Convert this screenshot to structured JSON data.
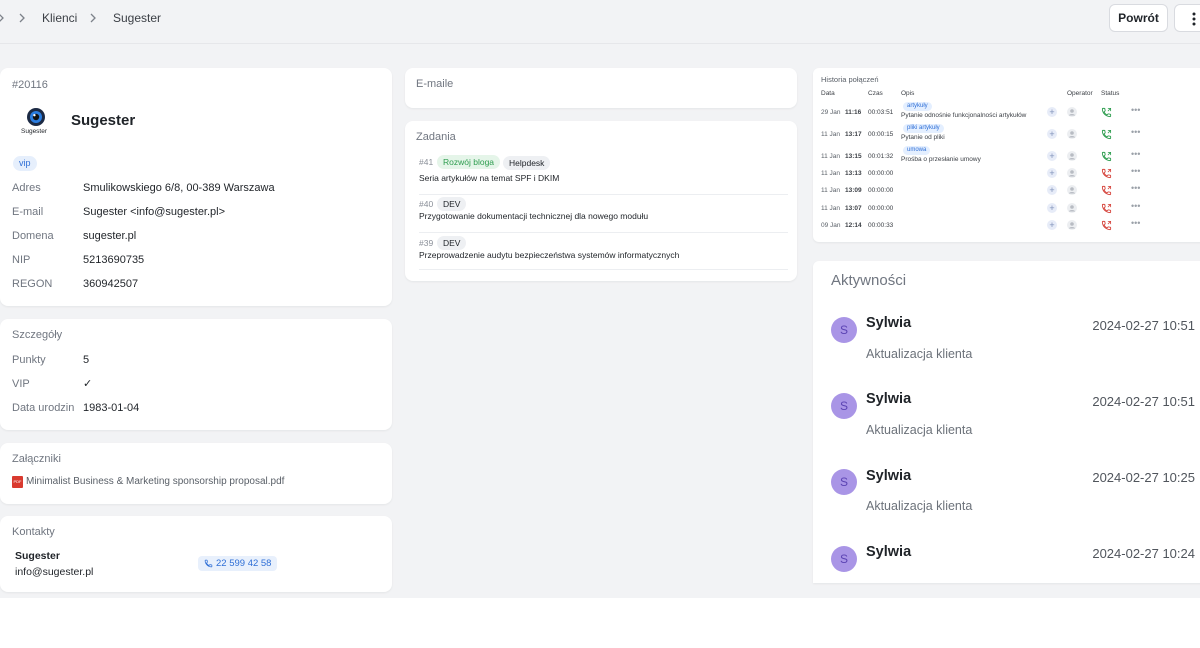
{
  "breadcrumb": {
    "items": [
      "Klienci",
      "Sugester"
    ]
  },
  "header": {
    "back_label": "Powrót"
  },
  "client": {
    "id": "#20116",
    "logo_text": "Sugester",
    "name": "Sugester",
    "tag": "vip",
    "fields": [
      {
        "label": "Adres",
        "value": "Smulikowskiego 6/8, 00-389 Warszawa"
      },
      {
        "label": "E-mail",
        "value": "Sugester <info@sugester.pl>"
      },
      {
        "label": "Domena",
        "value": "sugester.pl"
      },
      {
        "label": "NIP",
        "value": "5213690735"
      },
      {
        "label": "REGON",
        "value": "360942507"
      }
    ]
  },
  "details": {
    "title": "Szczegóły",
    "fields": [
      {
        "label": "Punkty",
        "value": "5"
      },
      {
        "label": "VIP",
        "value": "✓"
      },
      {
        "label": "Data urodzin",
        "value": "1983-01-04"
      }
    ]
  },
  "attachments": {
    "title": "Załączniki",
    "file_icon": "PDF",
    "files": [
      "Minimalist Business & Marketing sponsorship proposal.pdf"
    ]
  },
  "contacts": {
    "title": "Kontakty",
    "items": [
      {
        "name": "Sugester",
        "email": "info@sugester.pl",
        "phone": "22 599 42 58"
      }
    ]
  },
  "emails": {
    "title": "E-maile"
  },
  "tasks": {
    "title": "Zadania",
    "items": [
      {
        "number": "#41",
        "tags": [
          "Rozwój bloga",
          "Helpdesk"
        ],
        "title": "Seria artykułów na temat SPF i DKIM"
      },
      {
        "number": "#40",
        "tags": [
          "DEV"
        ],
        "title": "Przygotowanie dokumentacji technicznej dla nowego modułu"
      },
      {
        "number": "#39",
        "tags": [
          "DEV"
        ],
        "title": "Przeprowadzenie audytu bezpieczeństwa systemów informatycznych"
      }
    ]
  },
  "call_history": {
    "title": "Historia połączeń",
    "columns": [
      "Data",
      "Czas",
      "Opis",
      "Operator",
      "Status"
    ],
    "rows": [
      {
        "date": "29 Jan",
        "time": "11:16",
        "duration": "00:03:51",
        "tag": "artykuły",
        "desc": "Pytanie odnośnie funkcjonalności artykułów",
        "status": "answered"
      },
      {
        "date": "11 Jan",
        "time": "13:17",
        "duration": "00:00:15",
        "tag": "pliki artykuły",
        "desc": "Pytanie od pliki",
        "status": "answered"
      },
      {
        "date": "11 Jan",
        "time": "13:15",
        "duration": "00:01:32",
        "tag": "umowa",
        "desc": "Prośba o przesłanie umowy",
        "status": "answered"
      },
      {
        "date": "11 Jan",
        "time": "13:13",
        "duration": "00:00:00",
        "tag": "",
        "desc": "",
        "status": "missed"
      },
      {
        "date": "11 Jan",
        "time": "13:09",
        "duration": "00:00:00",
        "tag": "",
        "desc": "",
        "status": "missed"
      },
      {
        "date": "11 Jan",
        "time": "13:07",
        "duration": "00:00:00",
        "tag": "",
        "desc": "",
        "status": "missed"
      },
      {
        "date": "09 Jan",
        "time": "12:14",
        "duration": "00:00:33",
        "tag": "",
        "desc": "",
        "status": "missed"
      }
    ]
  },
  "activities": {
    "title": "Aktywności",
    "items": [
      {
        "initial": "S",
        "name": "Sylwia",
        "date": "2024-02-27 10:51",
        "desc": "Aktualizacja klienta"
      },
      {
        "initial": "S",
        "name": "Sylwia",
        "date": "2024-02-27 10:51",
        "desc": "Aktualizacja klienta"
      },
      {
        "initial": "S",
        "name": "Sylwia",
        "date": "2024-02-27 10:25",
        "desc": "Aktualizacja klienta"
      },
      {
        "initial": "S",
        "name": "Sylwia",
        "date": "2024-02-27 10:24",
        "desc": ""
      }
    ]
  },
  "colors": {
    "background": "#f2f3f5",
    "card": "#ffffff",
    "accent_blue": "#2f6fd6",
    "tag_green": "#2e9d4f",
    "call_answered": "#2e9d4f",
    "call_missed": "#d6453d",
    "avatar": "#a995e6"
  }
}
